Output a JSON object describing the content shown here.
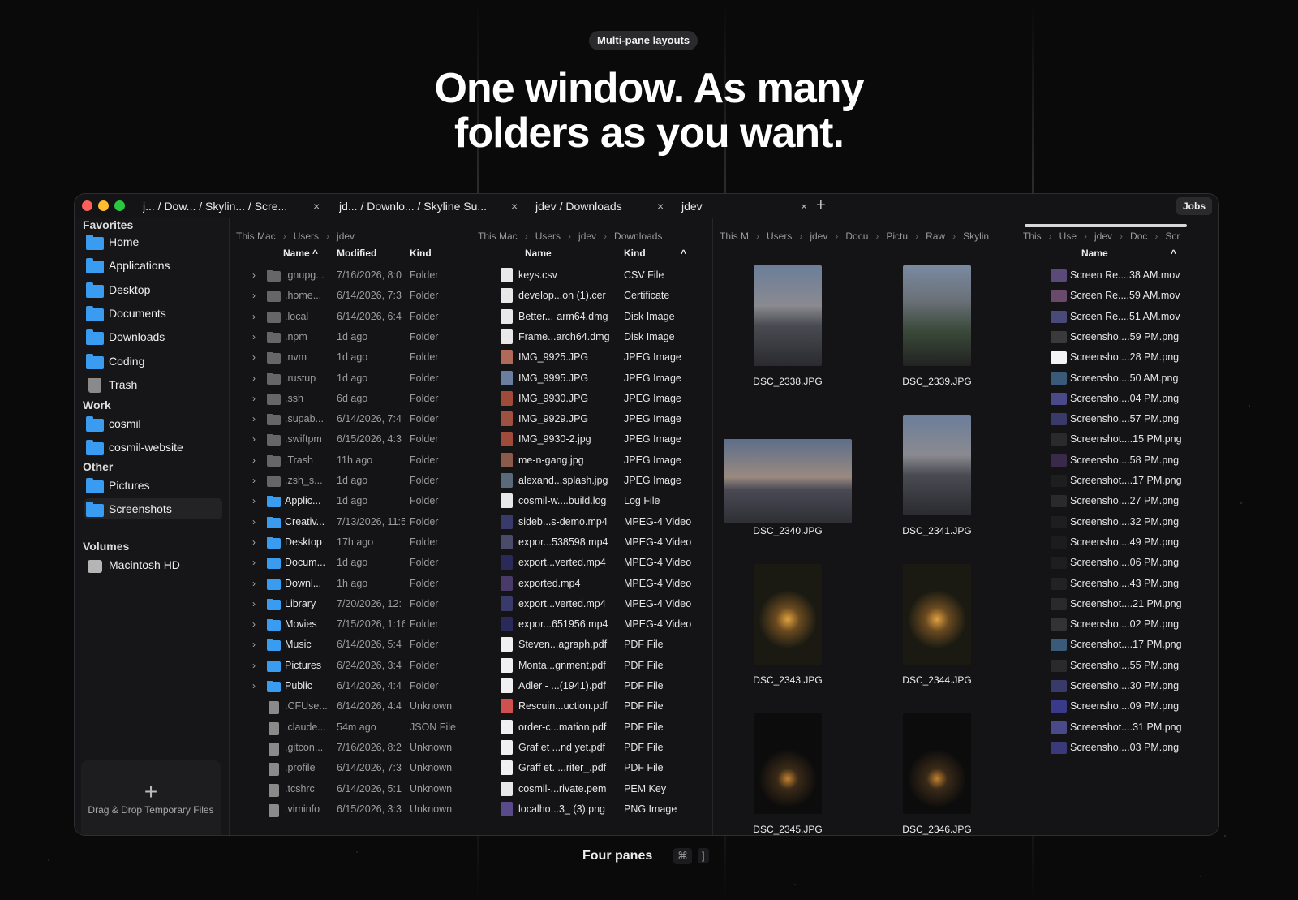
{
  "pill": "Multi-pane layouts",
  "headline": [
    "One window. As many",
    "folders as you want."
  ],
  "tabs": [
    {
      "label": "j... / Dow... / Skylin...  / Scre..."
    },
    {
      "label": "jd... / Downlo...  / Skyline Su..."
    },
    {
      "label": "jdev / Downloads"
    },
    {
      "label": "jdev"
    }
  ],
  "tab_new": "+",
  "jobs": "Jobs",
  "sidebar": {
    "favorites": "Favorites",
    "fav_items": [
      "Home",
      "Applications",
      "Desktop",
      "Documents",
      "Downloads",
      "Coding",
      "Trash"
    ],
    "work": "Work",
    "work_items": [
      "cosmil",
      "cosmil-website"
    ],
    "other": "Other",
    "other_items": [
      "Pictures",
      "Screenshots"
    ],
    "volumes": "Volumes",
    "volume_items": [
      "Macintosh HD"
    ],
    "dropzone_plus": "+",
    "dropzone": "Drag & Drop Temporary Files"
  },
  "pane1": {
    "crumbs": [
      "This Mac",
      "Users",
      "jdev"
    ],
    "headers": {
      "name": "Name",
      "sort": "^",
      "modified": "Modified",
      "kind": "Kind"
    },
    "rows": [
      {
        "name": ".gnupg...",
        "mod": "7/16/2026, 8:0",
        "kind": "Folder",
        "t": "f"
      },
      {
        "name": ".home...",
        "mod": "6/14/2026, 7:3",
        "kind": "Folder",
        "t": "f"
      },
      {
        "name": ".local",
        "mod": "6/14/2026, 6:4",
        "kind": "Folder",
        "t": "f"
      },
      {
        "name": ".npm",
        "mod": "1d ago",
        "kind": "Folder",
        "t": "f"
      },
      {
        "name": ".nvm",
        "mod": "1d ago",
        "kind": "Folder",
        "t": "f"
      },
      {
        "name": ".rustup",
        "mod": "1d ago",
        "kind": "Folder",
        "t": "f"
      },
      {
        "name": ".ssh",
        "mod": "6d ago",
        "kind": "Folder",
        "t": "f"
      },
      {
        "name": ".supab...",
        "mod": "6/14/2026, 7:4",
        "kind": "Folder",
        "t": "f"
      },
      {
        "name": ".swiftpm",
        "mod": "6/15/2026, 4:3",
        "kind": "Folder",
        "t": "f"
      },
      {
        "name": ".Trash",
        "mod": "11h ago",
        "kind": "Folder",
        "t": "t"
      },
      {
        "name": ".zsh_s...",
        "mod": "1d ago",
        "kind": "Folder",
        "t": "f"
      },
      {
        "name": "Applic...",
        "mod": "1d ago",
        "kind": "Folder",
        "t": "b"
      },
      {
        "name": "Creativ...",
        "mod": "7/13/2026, 11:5",
        "kind": "Folder",
        "t": "b"
      },
      {
        "name": "Desktop",
        "mod": "17h ago",
        "kind": "Folder",
        "t": "b"
      },
      {
        "name": "Docum...",
        "mod": "1d ago",
        "kind": "Folder",
        "t": "b"
      },
      {
        "name": "Downl...",
        "mod": "1h ago",
        "kind": "Folder",
        "t": "b"
      },
      {
        "name": "Library",
        "mod": "7/20/2026, 12:",
        "kind": "Folder",
        "t": "b"
      },
      {
        "name": "Movies",
        "mod": "7/15/2026, 1:16",
        "kind": "Folder",
        "t": "b"
      },
      {
        "name": "Music",
        "mod": "6/14/2026, 5:4",
        "kind": "Folder",
        "t": "b"
      },
      {
        "name": "Pictures",
        "mod": "6/24/2026, 3:4",
        "kind": "Folder",
        "t": "b"
      },
      {
        "name": "Public",
        "mod": "6/14/2026, 4:4",
        "kind": "Folder",
        "t": "b"
      },
      {
        "name": ".CFUse...",
        "mod": "6/14/2026, 4:4",
        "kind": "Unknown",
        "t": "d"
      },
      {
        "name": ".claude...",
        "mod": "54m ago",
        "kind": "JSON File",
        "t": "d"
      },
      {
        "name": ".gitcon...",
        "mod": "7/16/2026, 8:2",
        "kind": "Unknown",
        "t": "d"
      },
      {
        "name": ".profile",
        "mod": "6/14/2026, 7:3",
        "kind": "Unknown",
        "t": "d"
      },
      {
        "name": ".tcshrc",
        "mod": "6/14/2026, 5:1",
        "kind": "Unknown",
        "t": "d"
      },
      {
        "name": ".viminfo",
        "mod": "6/15/2026, 3:3",
        "kind": "Unknown",
        "t": "d"
      }
    ]
  },
  "pane2": {
    "crumbs": [
      "This Mac",
      "Users",
      "jdev",
      "Downloads"
    ],
    "headers": {
      "name": "Name",
      "kind": "Kind",
      "sort": "^"
    },
    "rows": [
      {
        "name": "keys.csv",
        "kind": "CSV File",
        "c": "#e8e8e8"
      },
      {
        "name": "develop...on (1).cer",
        "kind": "Certificate",
        "c": "#e8e8e8"
      },
      {
        "name": "Better...-arm64.dmg",
        "kind": "Disk Image",
        "c": "#e8e8e8"
      },
      {
        "name": "Frame...arch64.dmg",
        "kind": "Disk Image",
        "c": "#e8e8e8"
      },
      {
        "name": "IMG_9925.JPG",
        "kind": "JPEG Image",
        "c": "#b06a5a"
      },
      {
        "name": "IMG_9995.JPG",
        "kind": "JPEG Image",
        "c": "#6a7fa0"
      },
      {
        "name": "IMG_9930.JPG",
        "kind": "JPEG Image",
        "c": "#a04a3a"
      },
      {
        "name": "IMG_9929.JPG",
        "kind": "JPEG Image",
        "c": "#a05040"
      },
      {
        "name": "IMG_9930-2.jpg",
        "kind": "JPEG Image",
        "c": "#a04a3a"
      },
      {
        "name": "me-n-gang.jpg",
        "kind": "JPEG Image",
        "c": "#8a5a4a"
      },
      {
        "name": "alexand...splash.jpg",
        "kind": "JPEG Image",
        "c": "#5a6a7a"
      },
      {
        "name": "cosmil-w....build.log",
        "kind": "Log File",
        "c": "#e8e8e8"
      },
      {
        "name": "sideb...s-demo.mp4",
        "kind": "MPEG-4 Video",
        "c": "#3a3a6a"
      },
      {
        "name": "expor...538598.mp4",
        "kind": "MPEG-4 Video",
        "c": "#4a4a6a"
      },
      {
        "name": "export...verted.mp4",
        "kind": "MPEG-4 Video",
        "c": "#2a2a5a"
      },
      {
        "name": "exported.mp4",
        "kind": "MPEG-4 Video",
        "c": "#4a3a6a"
      },
      {
        "name": "export...verted.mp4",
        "kind": "MPEG-4 Video",
        "c": "#3a3a6a"
      },
      {
        "name": "expor...651956.mp4",
        "kind": "MPEG-4 Video",
        "c": "#2a2a5a"
      },
      {
        "name": "Steven...agraph.pdf",
        "kind": "PDF File",
        "c": "#f0f0f0"
      },
      {
        "name": "Monta...gnment.pdf",
        "kind": "PDF File",
        "c": "#f0f0f0"
      },
      {
        "name": "Adler - ...(1941).pdf",
        "kind": "PDF File",
        "c": "#f0f0f0"
      },
      {
        "name": "Rescuin...uction.pdf",
        "kind": "PDF File",
        "c": "#d05050"
      },
      {
        "name": "order-c...mation.pdf",
        "kind": "PDF File",
        "c": "#f0f0f0"
      },
      {
        "name": "Graf et ...nd yet.pdf",
        "kind": "PDF File",
        "c": "#f0f0f0"
      },
      {
        "name": "Graff et. ...riter_.pdf",
        "kind": "PDF File",
        "c": "#f0f0f0"
      },
      {
        "name": "cosmil-...rivate.pem",
        "kind": "PEM Key",
        "c": "#e8e8e8"
      },
      {
        "name": "localho...3_ (3).png",
        "kind": "PNG Image",
        "c": "#5a4a8a"
      }
    ]
  },
  "pane3": {
    "crumbs": [
      "This M",
      "Users",
      "jdev",
      "Docu",
      "Pictu",
      "Raw",
      "Skylin"
    ],
    "items": [
      {
        "name": "DSC_2338.JPG",
        "tone": "dusk"
      },
      {
        "name": "DSC_2339.JPG",
        "tone": "hill"
      },
      {
        "name": "DSC_2340.JPG",
        "tone": "wide"
      },
      {
        "name": "DSC_2341.JPG",
        "tone": "dusk"
      },
      {
        "name": "DSC_2343.JPG",
        "tone": "tree"
      },
      {
        "name": "DSC_2344.JPG",
        "tone": "tree"
      },
      {
        "name": "DSC_2345.JPG",
        "tone": "dark"
      },
      {
        "name": "DSC_2346.JPG",
        "tone": "dark"
      }
    ]
  },
  "pane4": {
    "crumbs": [
      "This",
      "Use",
      "jdev",
      "Doc",
      "Scr"
    ],
    "headers": {
      "name": "Name",
      "sort": "^"
    },
    "rows": [
      {
        "name": "Screen Re....38 AM.mov",
        "c": "#5a4a7a"
      },
      {
        "name": "Screen Re....59 AM.mov",
        "c": "#6a4a6a"
      },
      {
        "name": "Screen Re....51 AM.mov",
        "c": "#4a4a7a"
      },
      {
        "name": "Screensho....59 PM.png",
        "c": "#3a3a3a"
      },
      {
        "name": "Screensho....28 PM.png",
        "c": "#f4f4f4"
      },
      {
        "name": "Screensho....50 AM.png",
        "c": "#3a5a7a"
      },
      {
        "name": "Screensho....04 PM.png",
        "c": "#4a4a8a"
      },
      {
        "name": "Screensho....57 PM.png",
        "c": "#3a3a6a"
      },
      {
        "name": "Screenshot....15 PM.png",
        "c": "#2a2a2a"
      },
      {
        "name": "Screensho....58 PM.png",
        "c": "#3a2a4a"
      },
      {
        "name": "Screenshot....17 PM.png",
        "c": "#1e1e1e"
      },
      {
        "name": "Screensho....27 PM.png",
        "c": "#2a2a2a"
      },
      {
        "name": "Screensho....32 PM.png",
        "c": "#1e1e1e"
      },
      {
        "name": "Screensho....49 PM.png",
        "c": "#1c1c1c"
      },
      {
        "name": "Screensho....06 PM.png",
        "c": "#1e1e1e"
      },
      {
        "name": "Screensho....43 PM.png",
        "c": "#222"
      },
      {
        "name": "Screenshot....21 PM.png",
        "c": "#2a2a2a"
      },
      {
        "name": "Screensho....02 PM.png",
        "c": "#333"
      },
      {
        "name": "Screenshot....17 PM.png",
        "c": "#3a5a7a"
      },
      {
        "name": "Screensho....55 PM.png",
        "c": "#2a2a2a"
      },
      {
        "name": "Screensho....30 PM.png",
        "c": "#3a3a6a"
      },
      {
        "name": "Screensho....09 PM.png",
        "c": "#3a3a8a"
      },
      {
        "name": "Screenshot....31 PM.png",
        "c": "#4a4a8a"
      },
      {
        "name": "Screensho....03 PM.png",
        "c": "#3a3a7a"
      }
    ]
  },
  "footer": {
    "label": "Four panes",
    "key1": "⌘",
    "key2": "]"
  }
}
